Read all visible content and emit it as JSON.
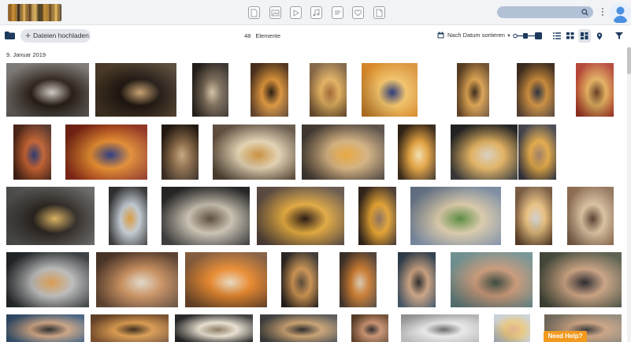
{
  "header": {
    "nav_icons": [
      "document-icon",
      "image-icon",
      "video-icon",
      "audio-icon",
      "document-text-icon",
      "heart-icon",
      "file-icon"
    ],
    "search": {
      "placeholder": ""
    }
  },
  "toolbar": {
    "upload_label": "Dateien hochladen",
    "count": "48",
    "count_label": "Elemente",
    "sort_label": "Nach Datum sortieren"
  },
  "gallery": {
    "date_heading": "9. Januar 2019",
    "thumbnails": [
      {
        "row": 1,
        "subject": "beer bottles on chalkboard (POPP)",
        "colors": [
          "#6f6b68",
          "#2a1f16",
          "#d0cbc5"
        ]
      },
      {
        "row": 1,
        "subject": "beer bottles with carrier",
        "colors": [
          "#4b3a28",
          "#1e1610",
          "#c7a070"
        ]
      },
      {
        "row": 1,
        "subject": "bottles on table",
        "colors": [
          "#2c2620",
          "#7a6a58",
          "#d2c2a6"
        ]
      },
      {
        "row": 1,
        "subject": "glass of beer",
        "colors": [
          "#5a3b24",
          "#d8923a",
          "#2a1a10"
        ]
      },
      {
        "row": 1,
        "subject": "burger and beer",
        "colors": [
          "#7a5a38",
          "#e1b060",
          "#a26a3a"
        ]
      },
      {
        "row": 1,
        "subject": "Moenchshof beer glass",
        "colors": [
          "#d88a2a",
          "#f1c26a",
          "#2a3a7a"
        ]
      },
      {
        "row": 1,
        "subject": "fries",
        "colors": [
          "#6a4a2a",
          "#d8a050",
          "#3a2a18"
        ]
      },
      {
        "row": 1,
        "subject": "beer glass in bar",
        "colors": [
          "#4a3526",
          "#c88a3a",
          "#2a3040"
        ]
      },
      {
        "row": 1,
        "subject": "fries in red basket",
        "colors": [
          "#b03a2a",
          "#e2b060",
          "#6a4028"
        ]
      },
      {
        "row": 2,
        "subject": "dark beer glass",
        "colors": [
          "#4a2518",
          "#c06030",
          "#2a3a70"
        ]
      },
      {
        "row": 2,
        "subject": "Moenchshof glass and fries",
        "colors": [
          "#8a2a18",
          "#e08a30",
          "#2a3a80"
        ]
      },
      {
        "row": 2,
        "subject": "crate of bottles",
        "colors": [
          "#2a1e14",
          "#8a6a48",
          "#c7a880"
        ]
      },
      {
        "row": 2,
        "subject": "chicken with bottle",
        "colors": [
          "#5a4a3a",
          "#e2d2b2",
          "#c89040"
        ]
      },
      {
        "row": 2,
        "subject": "beer and snacks",
        "colors": [
          "#4a4038",
          "#d2b080",
          "#e8a840"
        ]
      },
      {
        "row": 2,
        "subject": "Moenchshof glass",
        "colors": [
          "#3a2a1a",
          "#e0a040",
          "#f4e0b0"
        ]
      },
      {
        "row": 2,
        "subject": "beer glass and sign",
        "colors": [
          "#2a2a2a",
          "#e0b060",
          "#d8d0c0"
        ]
      },
      {
        "row": 2,
        "subject": "fries held in hands",
        "colors": [
          "#3a3a44",
          "#e0a848",
          "#a08068"
        ]
      },
      {
        "row": 3,
        "subject": "snack bowl on chalkboard",
        "colors": [
          "#5a5a58",
          "#2a2420",
          "#d8b060"
        ]
      },
      {
        "row": 3,
        "subject": "bottles and fries",
        "colors": [
          "#3a3a3a",
          "#c0c8d0",
          "#d89a40"
        ]
      },
      {
        "row": 3,
        "subject": "keep calm sign",
        "colors": [
          "#2e2e2e",
          "#c8c0b0",
          "#5a4a3a"
        ]
      },
      {
        "row": 3,
        "subject": "bottles and fries basket",
        "colors": [
          "#5a4a40",
          "#e0a840",
          "#2a1a14"
        ]
      },
      {
        "row": 3,
        "subject": "fries and bottles",
        "colors": [
          "#3a2a20",
          "#e0a030",
          "#8a7060"
        ]
      },
      {
        "row": 3,
        "subject": "wrap with salad",
        "colors": [
          "#7a8aa0",
          "#d8c8a8",
          "#5a8a40"
        ]
      },
      {
        "row": 3,
        "subject": "fries in cone",
        "colors": [
          "#6a4a30",
          "#e8c080",
          "#d0d0d0"
        ]
      },
      {
        "row": 3,
        "subject": "stacked food",
        "colors": [
          "#8a6a50",
          "#d8c0a0",
          "#5a4030"
        ]
      },
      {
        "row": 4,
        "subject": "Suesskartoffel chalkboard",
        "colors": [
          "#2a2e30",
          "#b8b8b8",
          "#d89a50"
        ]
      },
      {
        "row": 4,
        "subject": "chicken and snacks",
        "colors": [
          "#5a4030",
          "#c89060",
          "#e0d8c8"
        ]
      },
      {
        "row": 4,
        "subject": "sweet potato fries",
        "colors": [
          "#7a5030",
          "#e88a30",
          "#e8d8c0"
        ]
      },
      {
        "row": 4,
        "subject": "beer and burger",
        "colors": [
          "#2a2420",
          "#c89050",
          "#5a4a3a"
        ]
      },
      {
        "row": 4,
        "subject": "burger with beer",
        "colors": [
          "#4a3a30",
          "#c87a30",
          "#d8c8b0"
        ]
      },
      {
        "row": 4,
        "subject": "man with beer",
        "colors": [
          "#3a4a5a",
          "#c8a080",
          "#2a2a2a"
        ]
      },
      {
        "row": 4,
        "subject": "man with sunglasses",
        "colors": [
          "#6a8a8a",
          "#c89878",
          "#3a4a40"
        ]
      },
      {
        "row": 4,
        "subject": "tattooed man with beer",
        "colors": [
          "#4a5040",
          "#c8a080",
          "#2a2a30"
        ]
      },
      {
        "row": 5,
        "subject": "man with beer outdoors",
        "colors": [
          "#3a5a7a",
          "#c8a080",
          "#2a2a2a"
        ]
      },
      {
        "row": 5,
        "subject": "burger",
        "colors": [
          "#7a5030",
          "#d89a50",
          "#3a2a1a"
        ]
      },
      {
        "row": 5,
        "subject": "Mexican sign",
        "colors": [
          "#2a2a2a",
          "#e8e0d0",
          "#8a7a60"
        ]
      },
      {
        "row": 5,
        "subject": "food boxes",
        "colors": [
          "#4a4a4a",
          "#c8a070",
          "#2a2a2a"
        ]
      },
      {
        "row": 5,
        "subject": "bearded man",
        "colors": [
          "#6a4a30",
          "#c89070",
          "#2a2a2a"
        ]
      },
      {
        "row": 5,
        "subject": "food truck",
        "colors": [
          "#b8b8b8",
          "#e8e8e8",
          "#6a6a6a"
        ]
      },
      {
        "row": 5,
        "subject": "blonde woman",
        "colors": [
          "#c8d0d8",
          "#e8c880",
          "#e0b090"
        ]
      },
      {
        "row": 5,
        "subject": "man with beer",
        "colors": [
          "#8a8070",
          "#c8a080",
          "#3a3a3a"
        ]
      }
    ]
  },
  "help_button": {
    "label": "Need Help?",
    "color": "#f29a1e"
  },
  "colors": {
    "accent": "#1e3a5f",
    "search_bg": "#b3c1d6",
    "topbar_bg": "#f2f3f5"
  }
}
